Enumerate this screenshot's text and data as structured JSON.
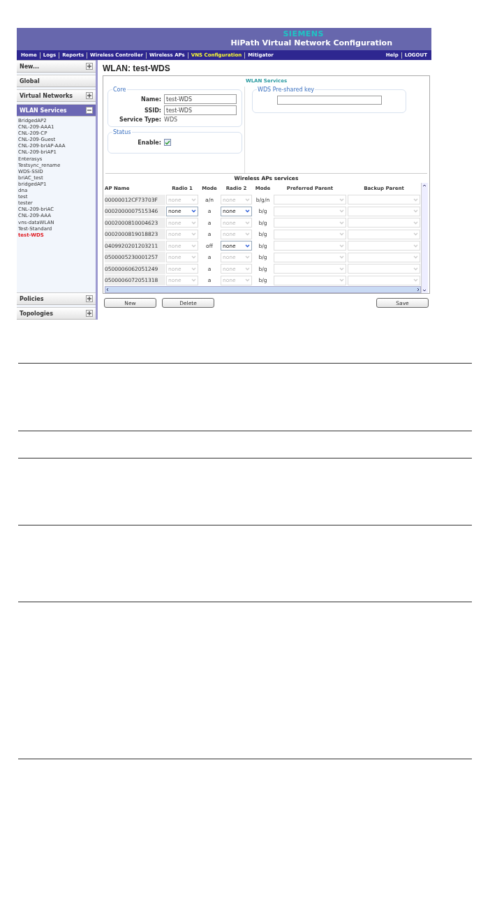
{
  "header": {
    "brand": "SIEMENS",
    "title": "HiPath Virtual Network Configuration"
  },
  "nav": {
    "items": [
      {
        "label": "Home",
        "selected": false
      },
      {
        "label": "Logs",
        "selected": false
      },
      {
        "label": "Reports",
        "selected": false
      },
      {
        "label": "Wireless Controller",
        "selected": false
      },
      {
        "label": "Wireless APs",
        "selected": false
      },
      {
        "label": "VNS Configuration",
        "selected": true
      },
      {
        "label": "Mitigator",
        "selected": false
      }
    ],
    "right_items": [
      {
        "label": "Help"
      },
      {
        "label": "LOGOUT"
      }
    ]
  },
  "sidebar": {
    "sections": [
      {
        "label": "New...",
        "kind": "toggle",
        "expanded": false,
        "selected": false
      },
      {
        "label": "Global",
        "kind": "plain",
        "selected": false
      },
      {
        "label": "Virtual Networks",
        "kind": "toggle",
        "expanded": false,
        "selected": false
      },
      {
        "label": "WLAN Services",
        "kind": "toggle",
        "expanded": true,
        "selected": true,
        "children": [
          {
            "label": "BridgedAP2",
            "selected": false
          },
          {
            "label": "CNL-209-AAA1",
            "selected": false
          },
          {
            "label": "CNL-209-CP",
            "selected": false
          },
          {
            "label": "CNL-209-Guest",
            "selected": false
          },
          {
            "label": "CNL-209-briAP-AAA",
            "selected": false
          },
          {
            "label": "CNL-209-briAP1",
            "selected": false
          },
          {
            "label": "Enterasys",
            "selected": false
          },
          {
            "label": "Testsync_rename",
            "selected": false
          },
          {
            "label": "WDS-SSID",
            "selected": false
          },
          {
            "label": "briAC_test",
            "selected": false
          },
          {
            "label": "bridgedAP1",
            "selected": false
          },
          {
            "label": "dna",
            "selected": false
          },
          {
            "label": "test",
            "selected": false
          },
          {
            "label": "tester",
            "selected": false
          },
          {
            "label": "CNL-209-briAC",
            "selected": false
          },
          {
            "label": "CNL-209-AAA",
            "selected": false
          },
          {
            "label": "vns-dataWLAN",
            "selected": false
          },
          {
            "label": "Test-Standard",
            "selected": false
          },
          {
            "label": "test-WDS",
            "selected": true
          }
        ]
      },
      {
        "label": "Policies",
        "kind": "toggle",
        "expanded": false,
        "selected": false
      },
      {
        "label": "Topologies",
        "kind": "toggle",
        "expanded": false,
        "selected": false
      }
    ]
  },
  "main": {
    "title": "WLAN: test-WDS",
    "panel": {
      "title": "WLAN Services",
      "core": {
        "legend": "Core",
        "fields": [
          {
            "label": "Name:",
            "kind": "input",
            "value": "test-WDS"
          },
          {
            "label": "SSID:",
            "kind": "input",
            "value": "test-WDS"
          },
          {
            "label": "Service Type:",
            "kind": "text",
            "value": "WDS"
          }
        ]
      },
      "status": {
        "legend": "Status",
        "enable": {
          "label": "Enable:",
          "checked": true
        }
      },
      "key": {
        "legend": "WDS Pre-shared key"
      },
      "table": {
        "title": "Wireless APs services",
        "columns": [
          "AP Name",
          "Radio 1",
          "Mode",
          "Radio 2",
          "Mode",
          "Preferred Parent",
          "Backup Parent"
        ],
        "rows": [
          {
            "ap_name": "00000012CF73703F",
            "radio_1": {
              "value": "none",
              "disabled": true
            },
            "mode_1": "a/n",
            "radio_2": {
              "value": "none",
              "disabled": true
            },
            "mode_2": "b/g/n"
          },
          {
            "ap_name": "0002000007515346",
            "radio_1": {
              "value": "none",
              "disabled": false
            },
            "mode_1": "a",
            "radio_2": {
              "value": "none",
              "disabled": false
            },
            "mode_2": "b/g"
          },
          {
            "ap_name": "0002000810004623",
            "radio_1": {
              "value": "none",
              "disabled": true
            },
            "mode_1": "a",
            "radio_2": {
              "value": "none",
              "disabled": true
            },
            "mode_2": "b/g"
          },
          {
            "ap_name": "0002000819018823",
            "radio_1": {
              "value": "none",
              "disabled": true
            },
            "mode_1": "a",
            "radio_2": {
              "value": "none",
              "disabled": true
            },
            "mode_2": "b/g"
          },
          {
            "ap_name": "0409920201203211",
            "radio_1": {
              "value": "none",
              "disabled": true
            },
            "mode_1": "off",
            "radio_2": {
              "value": "none",
              "disabled": false
            },
            "mode_2": "b/g"
          },
          {
            "ap_name": "0500005230001257",
            "radio_1": {
              "value": "none",
              "disabled": true
            },
            "mode_1": "a",
            "radio_2": {
              "value": "none",
              "disabled": true
            },
            "mode_2": "b/g"
          },
          {
            "ap_name": "0500006062051249",
            "radio_1": {
              "value": "none",
              "disabled": true
            },
            "mode_1": "a",
            "radio_2": {
              "value": "none",
              "disabled": true
            },
            "mode_2": "b/g"
          },
          {
            "ap_name": "0500006072051318",
            "radio_1": {
              "value": "none",
              "disabled": true
            },
            "mode_1": "a",
            "radio_2": {
              "value": "none",
              "disabled": true
            },
            "mode_2": "b/g"
          }
        ]
      }
    },
    "buttons_left": [
      {
        "label": "New"
      },
      {
        "label": "Delete"
      }
    ],
    "buttons_right": [
      {
        "label": "Save"
      }
    ]
  }
}
